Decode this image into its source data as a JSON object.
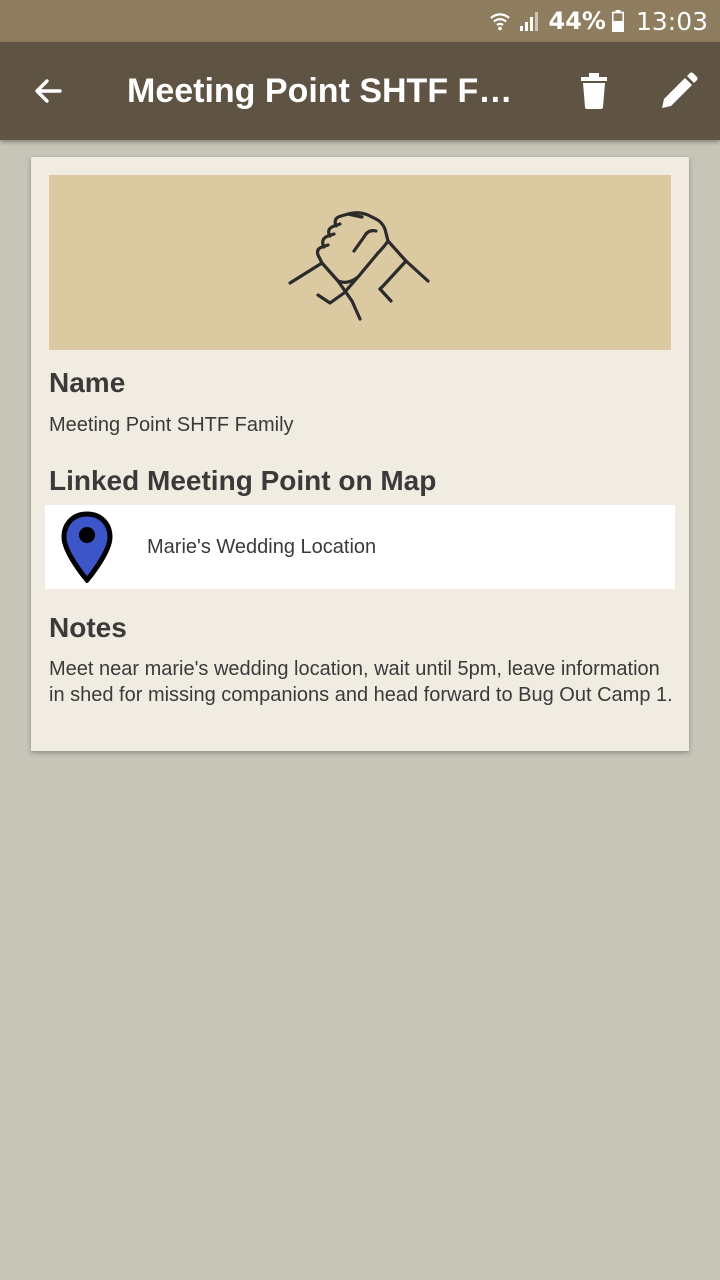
{
  "status_bar": {
    "battery": "44%",
    "time": "13:03",
    "icons": [
      "wifi-icon",
      "signal-icon",
      "battery-icon"
    ]
  },
  "toolbar": {
    "title": "Meeting Point SHTF Family",
    "back_icon": "arrow-left-icon",
    "delete_icon": "trash-icon",
    "edit_icon": "pencil-icon"
  },
  "card": {
    "banner_icon": "handshake-icon",
    "name_label": "Name",
    "name_value": "Meeting Point SHTF Family",
    "linked_label": "Linked Meeting Point on Map",
    "linked_point": {
      "icon": "map-pin-icon",
      "name": "Marie's Wedding Location"
    },
    "notes_label": "Notes",
    "notes_value": "Meet near marie's wedding location, wait until 5pm, leave information in shed for missing companions and head forward to Bug Out Camp 1."
  },
  "colors": {
    "status_bar": "#8e7d5e",
    "toolbar": "#5f5343",
    "background": "#c6c6b8",
    "card": "#f1ece1",
    "banner": "#dbc9a2",
    "pin": "#3c55c8"
  }
}
